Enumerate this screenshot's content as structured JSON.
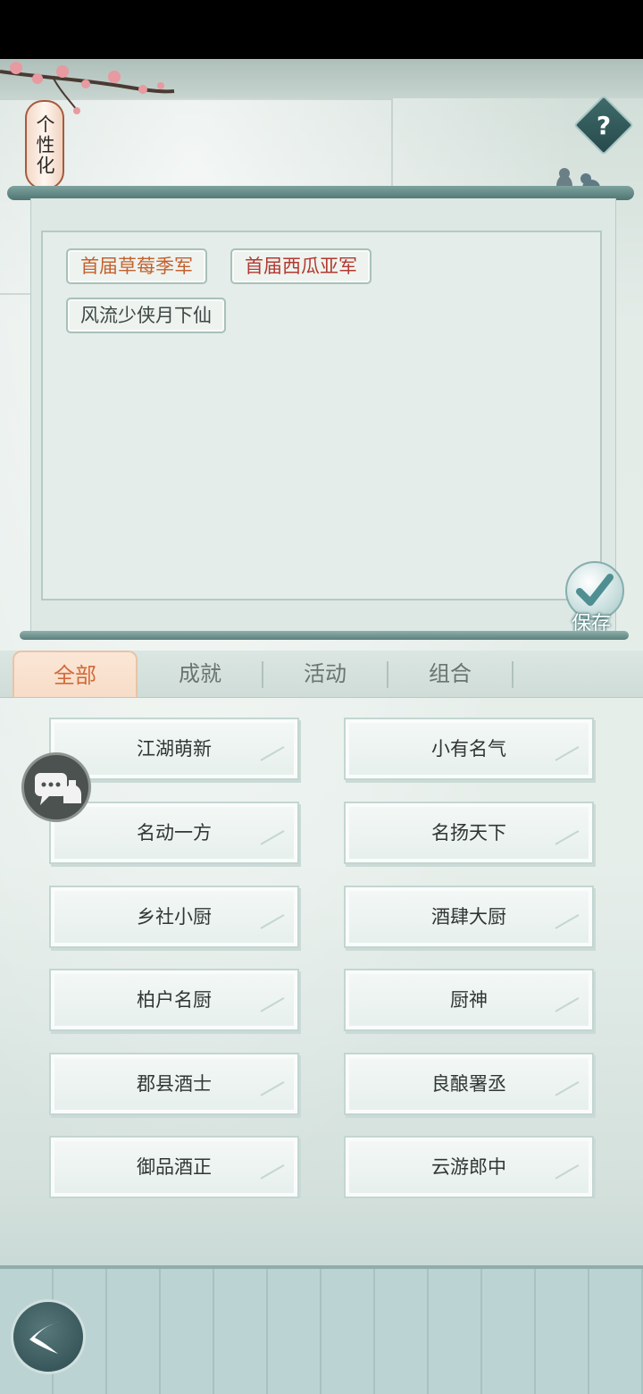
{
  "header": {
    "title": "个性化",
    "help_label": "?"
  },
  "selected_titles": [
    {
      "label": "首届草莓季军",
      "color": "orange"
    },
    {
      "label": "首届西瓜亚军",
      "color": "red"
    },
    {
      "label": "风流少侠月下仙",
      "color": "dark"
    }
  ],
  "save": {
    "label": "保存"
  },
  "tabs": [
    {
      "label": "全部",
      "active": true
    },
    {
      "label": "成就",
      "active": false
    },
    {
      "label": "活动",
      "active": false
    },
    {
      "label": "组合",
      "active": false
    }
  ],
  "titles": [
    "江湖萌新",
    "小有名气",
    "名动一方",
    "名扬天下",
    "乡社小厨",
    "酒肆大厨",
    "柏户名厨",
    "厨神",
    "郡县酒士",
    "良酿署丞",
    "御品酒正",
    "云游郎中"
  ],
  "colors": {
    "accent_orange": "#d16a3a",
    "teal": "#3f6b6a"
  }
}
